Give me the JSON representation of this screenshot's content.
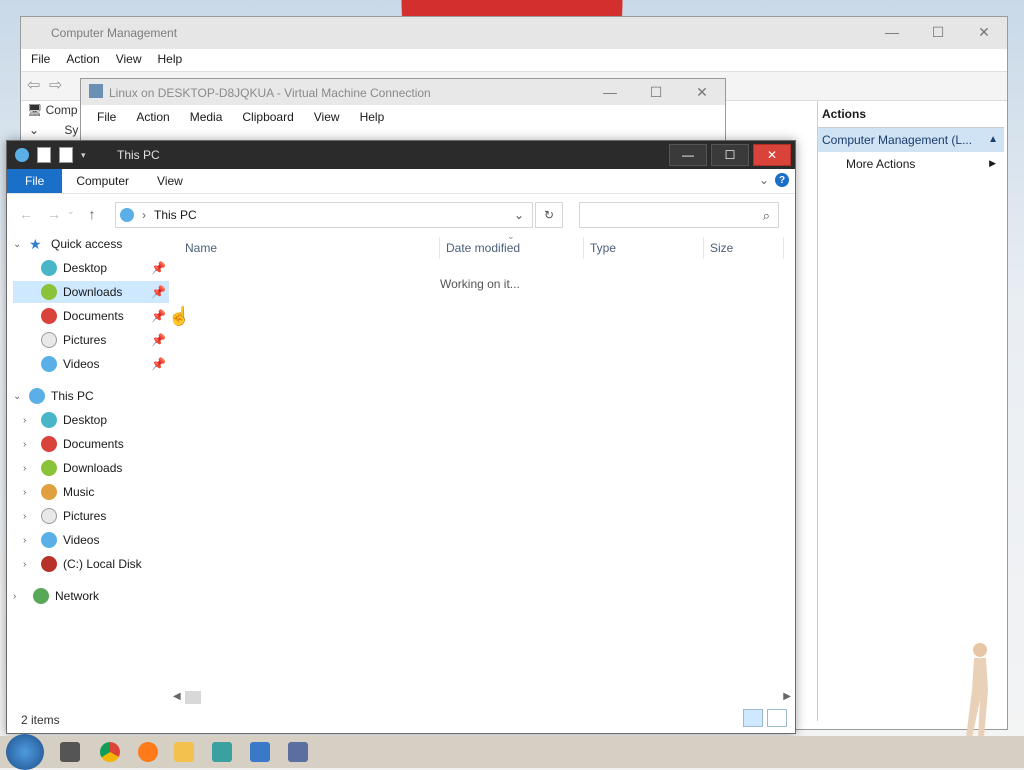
{
  "computer_management": {
    "title": "Computer Management",
    "menu": [
      "File",
      "Action",
      "View",
      "Help"
    ],
    "tree_items": [
      "Comp",
      "Sy"
    ],
    "actions": {
      "header": "Actions",
      "group": "Computer Management (L...",
      "more": "More Actions"
    }
  },
  "vm_window": {
    "title": "Linux on DESKTOP-D8JQKUA - Virtual Machine Connection",
    "menu": [
      "File",
      "Action",
      "Media",
      "Clipboard",
      "View",
      "Help"
    ]
  },
  "explorer": {
    "title": "This PC",
    "ribbon": {
      "file": "File",
      "computer": "Computer",
      "view": "View",
      "help": "?"
    },
    "address": "This PC",
    "search_placeholder": "",
    "columns": [
      "Name",
      "Date modified",
      "Type",
      "Size"
    ],
    "working": "Working on it...",
    "status": "2 items",
    "tree": {
      "quick_access": "Quick access",
      "quick_items": [
        "Desktop",
        "Downloads",
        "Documents",
        "Pictures",
        "Videos"
      ],
      "this_pc": "This PC",
      "pc_items": [
        "Desktop",
        "Documents",
        "Downloads",
        "Music",
        "Pictures",
        "Videos",
        "(C:) Local Disk"
      ],
      "network": "Network"
    }
  },
  "colors": {
    "accent": "#1a6fc9",
    "selection": "#cde8ff",
    "close_red": "#d9433a",
    "wallpaper_red": "#d32f2f"
  }
}
